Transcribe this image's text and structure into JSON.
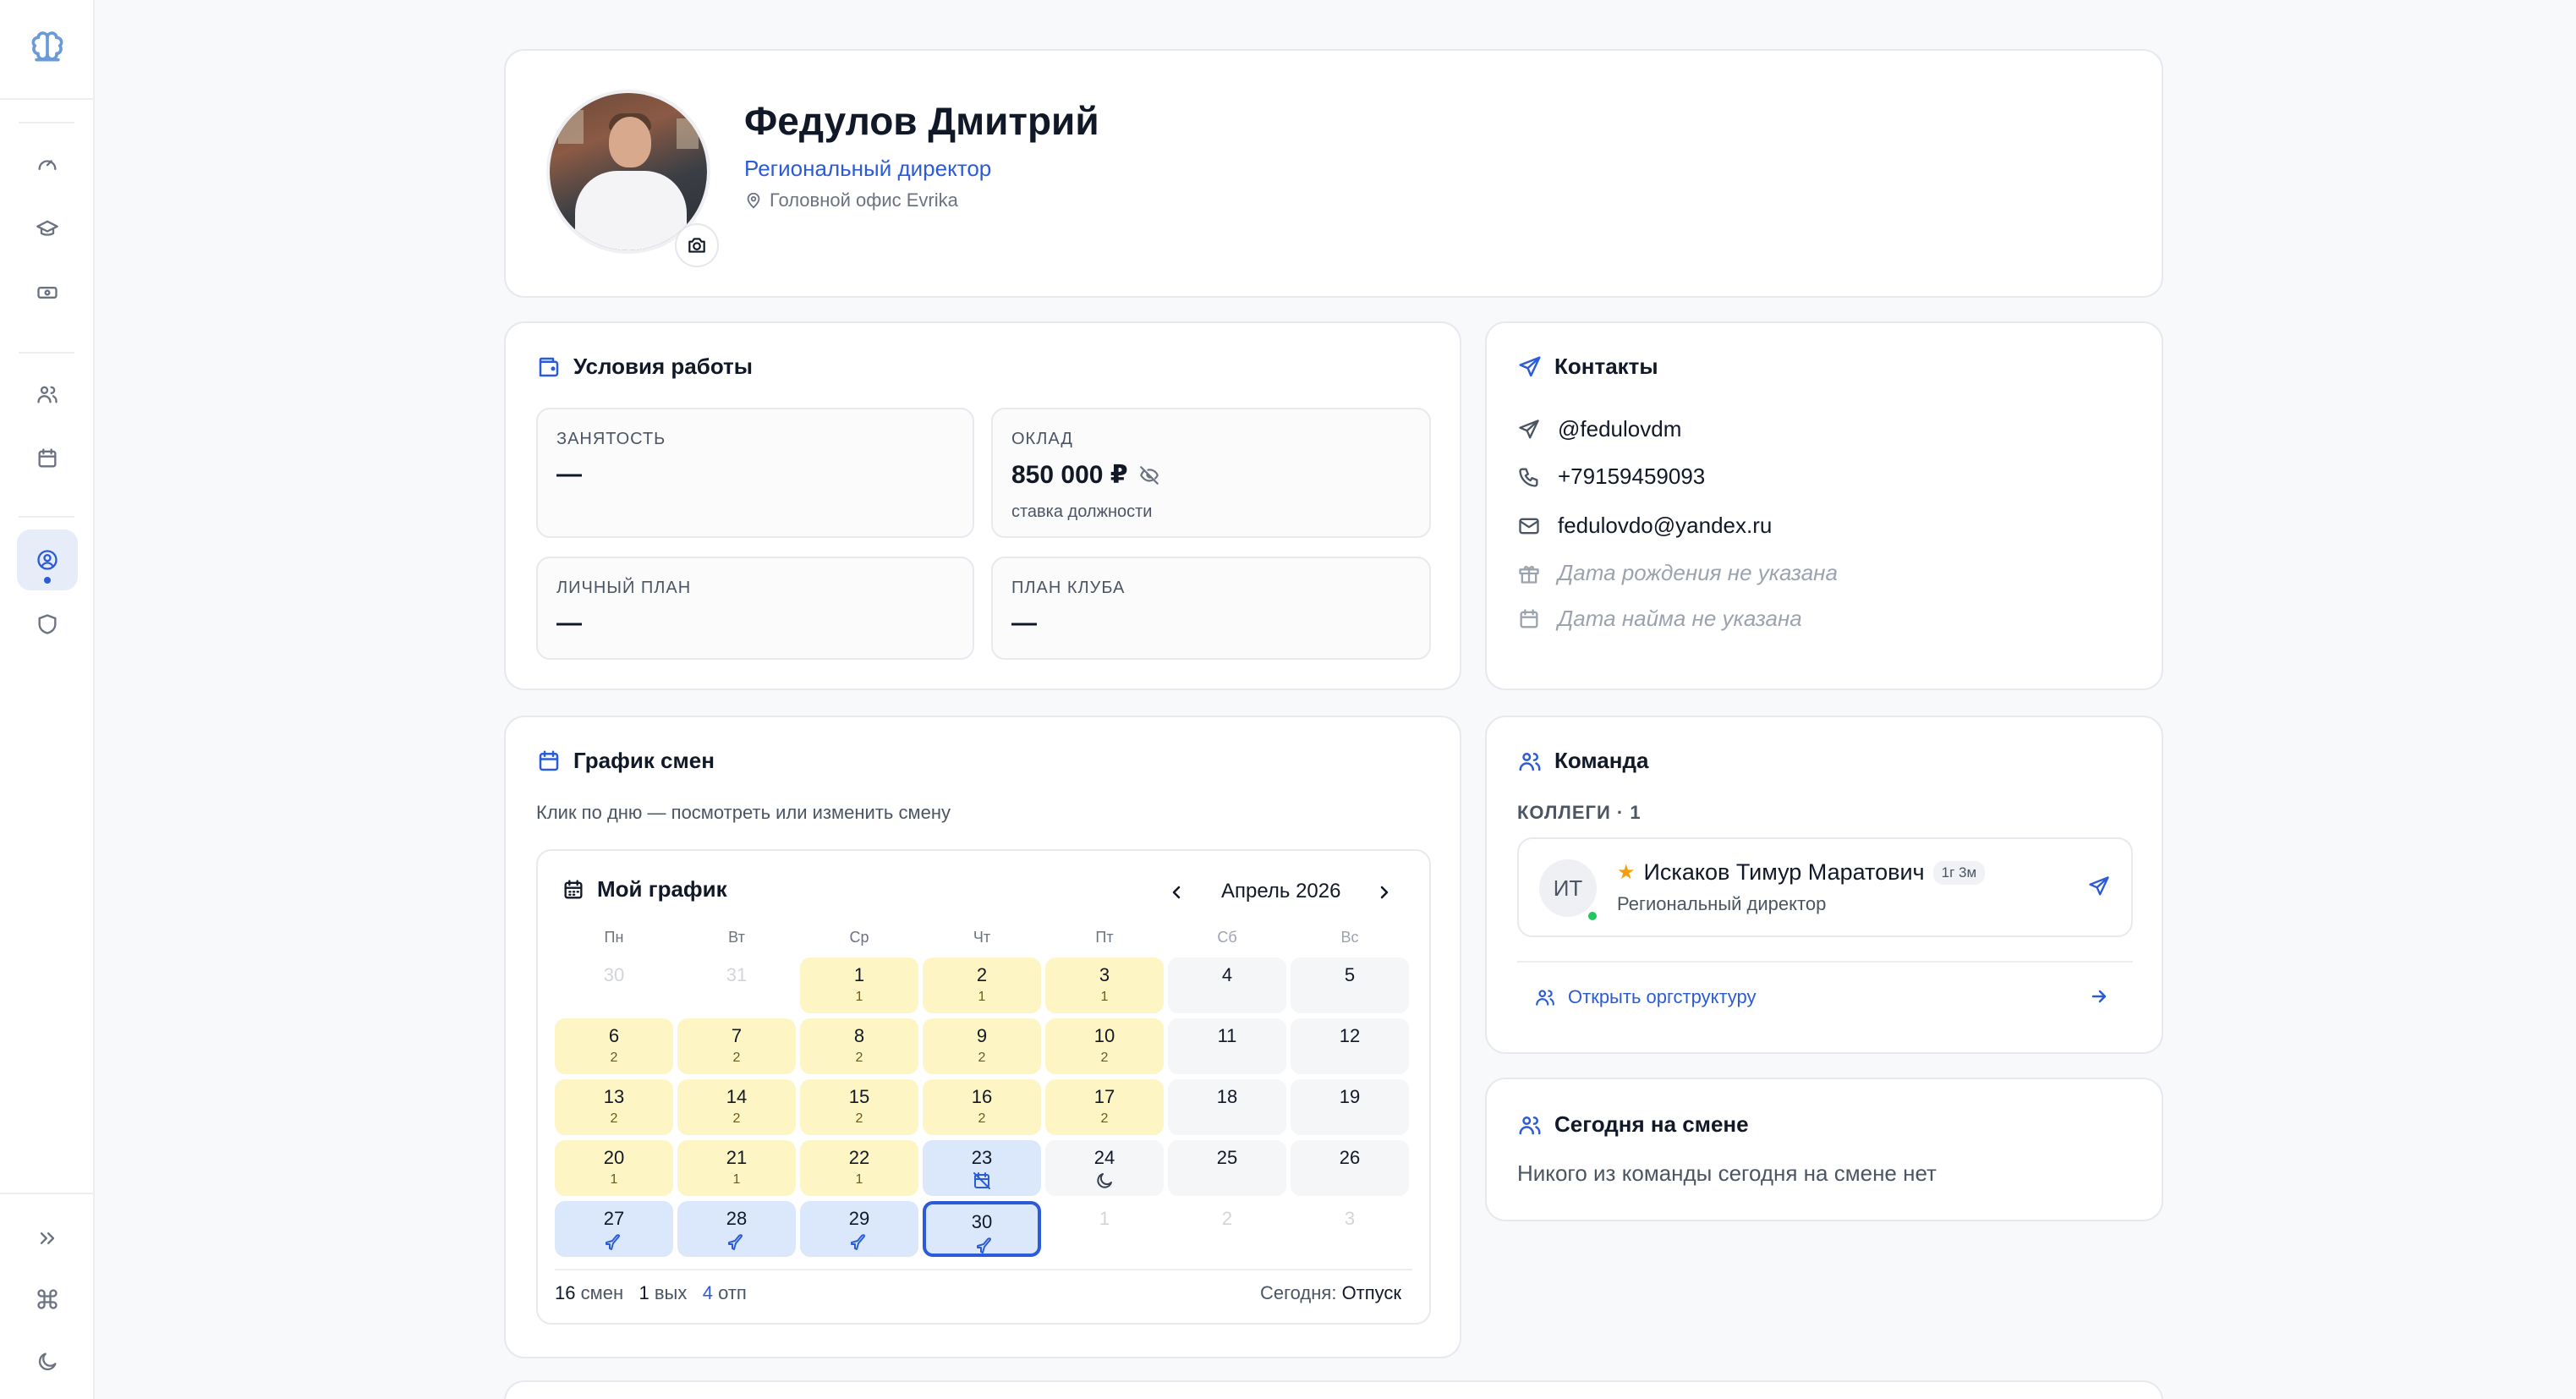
{
  "profile": {
    "name": "Федулов Дмитрий",
    "role": "Региональный директор",
    "location": "Головной офис Evrika"
  },
  "work_conditions": {
    "title": "Условия работы",
    "tiles": [
      {
        "label": "ЗАНЯТОСТЬ",
        "value": "—"
      },
      {
        "label": "ОКЛАД",
        "value": "850 000 ₽",
        "sub": "ставка должности"
      },
      {
        "label": "ЛИЧНЫЙ ПЛАН",
        "value": "—"
      },
      {
        "label": "ПЛАН КЛУБА",
        "value": "—"
      }
    ]
  },
  "contacts": {
    "title": "Контакты",
    "telegram": "@fedulovdm",
    "phone": "+79159459093",
    "email": "fedulovdo@yandex.ru",
    "birthday": "Дата рождения не указана",
    "hire_date": "Дата найма не указана"
  },
  "schedule": {
    "title": "График смен",
    "subtitle": "Клик по дню — посмотреть или изменить смену",
    "calendar_title": "Мой график",
    "month": "Апрель 2026",
    "weekdays": [
      "Пн",
      "Вт",
      "Ср",
      "Чт",
      "Пт",
      "Сб",
      "Вс"
    ],
    "days": [
      {
        "n": "30",
        "t": "out"
      },
      {
        "n": "31",
        "t": "out"
      },
      {
        "n": "1",
        "t": "work",
        "s": "1"
      },
      {
        "n": "2",
        "t": "work",
        "s": "1"
      },
      {
        "n": "3",
        "t": "work",
        "s": "1"
      },
      {
        "n": "4",
        "t": "off"
      },
      {
        "n": "5",
        "t": "off"
      },
      {
        "n": "6",
        "t": "work",
        "s": "2"
      },
      {
        "n": "7",
        "t": "work",
        "s": "2"
      },
      {
        "n": "8",
        "t": "work",
        "s": "2"
      },
      {
        "n": "9",
        "t": "work",
        "s": "2"
      },
      {
        "n": "10",
        "t": "work",
        "s": "2"
      },
      {
        "n": "11",
        "t": "off"
      },
      {
        "n": "12",
        "t": "off"
      },
      {
        "n": "13",
        "t": "work",
        "s": "2"
      },
      {
        "n": "14",
        "t": "work",
        "s": "2"
      },
      {
        "n": "15",
        "t": "work",
        "s": "2"
      },
      {
        "n": "16",
        "t": "work",
        "s": "2"
      },
      {
        "n": "17",
        "t": "work",
        "s": "2"
      },
      {
        "n": "18",
        "t": "off"
      },
      {
        "n": "19",
        "t": "off"
      },
      {
        "n": "20",
        "t": "work",
        "s": "1"
      },
      {
        "n": "21",
        "t": "work",
        "s": "1"
      },
      {
        "n": "22",
        "t": "work",
        "s": "1"
      },
      {
        "n": "23",
        "t": "vac",
        "icon": "calendar-off-icon"
      },
      {
        "n": "24",
        "t": "off",
        "icon": "moon-icon"
      },
      {
        "n": "25",
        "t": "off"
      },
      {
        "n": "26",
        "t": "off"
      },
      {
        "n": "27",
        "t": "vac",
        "icon": "plane-icon"
      },
      {
        "n": "28",
        "t": "vac",
        "icon": "plane-icon"
      },
      {
        "n": "29",
        "t": "vac",
        "icon": "plane-icon"
      },
      {
        "n": "30",
        "t": "vac",
        "icon": "plane-icon",
        "today": true
      },
      {
        "n": "1",
        "t": "out"
      },
      {
        "n": "2",
        "t": "out"
      },
      {
        "n": "3",
        "t": "out"
      }
    ],
    "stats": {
      "shifts_num": "16",
      "shifts_label": "смен",
      "off_num": "1",
      "off_label": "вых",
      "vac_num": "4",
      "vac_label": "отп",
      "today_label": "Сегодня:",
      "today_value": "Отпуск"
    },
    "colors": {
      "work": "#fdf6c4",
      "off": "#f5f6f8",
      "vacation": "#dbe7fb",
      "accent": "#2b5bd7"
    }
  },
  "team": {
    "title": "Команда",
    "colleagues_label": "КОЛЛЕГИ · 1",
    "member": {
      "initials": "ИТ",
      "name": "Искаков Тимур Маратович",
      "tenure": "1г 3м",
      "role": "Региональный директор"
    },
    "org_link": "Открыть оргструктуру"
  },
  "on_shift": {
    "title": "Сегодня на смене",
    "empty": "Никого из команды сегодня на смене нет"
  }
}
